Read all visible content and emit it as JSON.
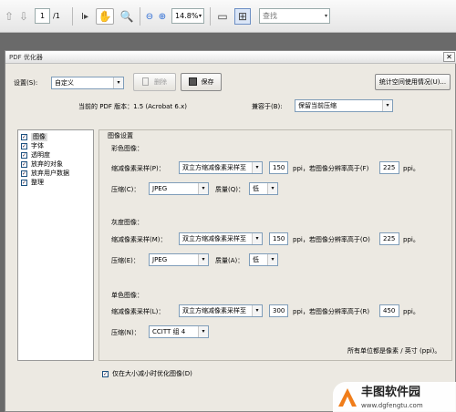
{
  "toolbar": {
    "page_current": "1",
    "page_total": "/1",
    "zoom": "14.8%",
    "search_placeholder": "查找"
  },
  "dialog": {
    "title": "PDF 优化器",
    "settings_label": "设置(S):",
    "preset_value": "自定义",
    "delete_label": "删除",
    "save_label": "保存",
    "audit_label": "统计空间使用情况(U)...",
    "version_label": "当前的 PDF 版本：1.5 (Acrobat 6.x)",
    "compat_label": "兼容于(B):",
    "compat_value": "保留当前压缩",
    "categories": [
      {
        "label": "图像",
        "checked": true
      },
      {
        "label": "字体",
        "checked": true
      },
      {
        "label": "透明度",
        "checked": true
      },
      {
        "label": "放弃的对象",
        "checked": true
      },
      {
        "label": "放弃用户数据",
        "checked": true
      },
      {
        "label": "整理",
        "checked": true
      }
    ],
    "image_settings_title": "图像设置",
    "color": {
      "title": "彩色图像：",
      "downsample_label": "缩减像素采样(P)：",
      "downsample_value": "双立方缩减像素采样至",
      "ppi_value": "150",
      "ppi_text": "ppi，若图像分辨率高于(F)",
      "above_value": "225",
      "ppi_unit": "ppi。",
      "compression_label": "压缩(C)：",
      "compression_value": "JPEG",
      "quality_label": "质量(Q)：",
      "quality_value": "低"
    },
    "gray": {
      "title": "灰度图像：",
      "downsample_label": "缩减像素采样(M)：",
      "downsample_value": "双立方缩减像素采样至",
      "ppi_value": "150",
      "ppi_text": "ppi，若图像分辨率高于(O)",
      "above_value": "225",
      "ppi_unit": "ppi。",
      "compression_label": "压缩(E)：",
      "compression_value": "JPEG",
      "quality_label": "质量(A)：",
      "quality_value": "低"
    },
    "mono": {
      "title": "单色图像：",
      "downsample_label": "缩减像素采样(L)：",
      "downsample_value": "双立方缩减像素采样至",
      "ppi_value": "300",
      "ppi_text": "ppi，若图像分辨率高于(R)",
      "above_value": "450",
      "ppi_unit": "ppi。",
      "compression_label": "压缩(N)：",
      "compression_value": "CCITT 组 4"
    },
    "units_note": "所有单位都是像素 / 英寸 (ppi)。",
    "optimize_label": "仅在大小减小时优化图像(D)"
  },
  "watermark": {
    "brand": "丰图软件园",
    "url": "www.dgfengtu.com"
  },
  "colors": {
    "accent": "#2a6ad4",
    "brand_orange": "#f07d1a",
    "dialog_bg": "#ece9e2"
  }
}
